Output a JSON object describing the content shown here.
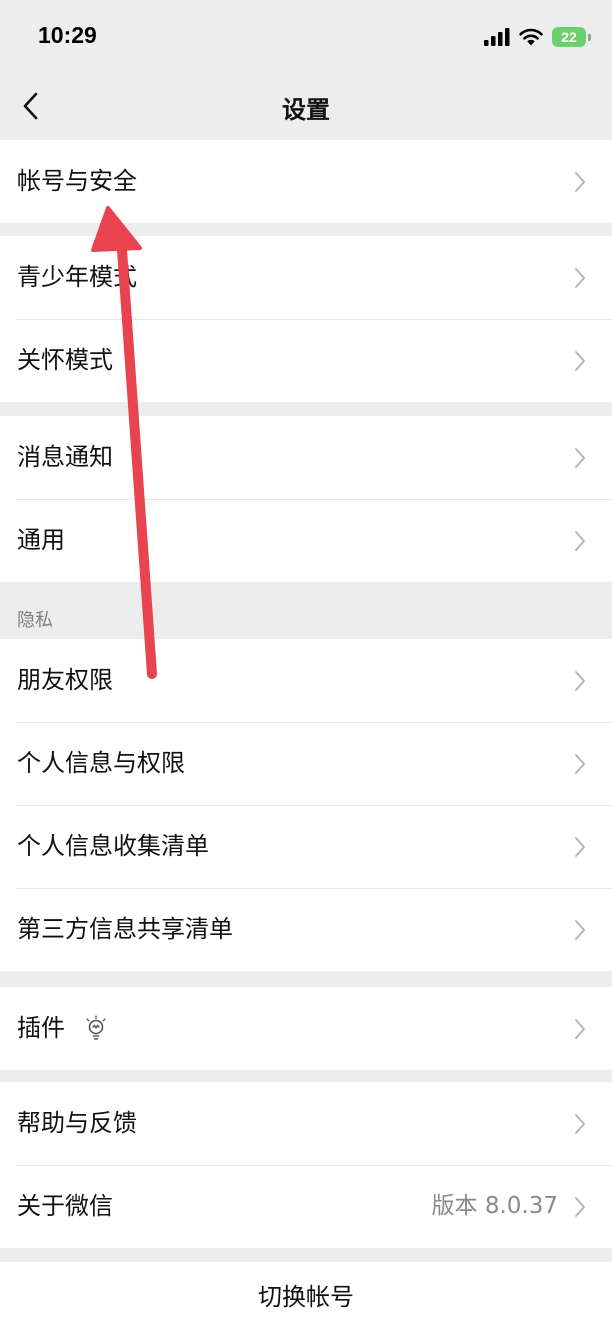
{
  "status_bar": {
    "time": "10:29",
    "battery": "22"
  },
  "nav": {
    "title": "设置"
  },
  "groups": {
    "account": {
      "items": [
        {
          "label": "帐号与安全"
        }
      ]
    },
    "modes": {
      "items": [
        {
          "label": "青少年模式"
        },
        {
          "label": "关怀模式"
        }
      ]
    },
    "general": {
      "items": [
        {
          "label": "消息通知"
        },
        {
          "label": "通用"
        }
      ]
    },
    "privacy": {
      "header": "隐私",
      "items": [
        {
          "label": "朋友权限"
        },
        {
          "label": "个人信息与权限"
        },
        {
          "label": "个人信息收集清单"
        },
        {
          "label": "第三方信息共享清单"
        }
      ]
    },
    "plugins": {
      "items": [
        {
          "label": "插件",
          "icon": "lightbulb-icon"
        }
      ]
    },
    "about": {
      "items": [
        {
          "label": "帮助与反馈"
        },
        {
          "label": "关于微信",
          "value": "版本 8.0.37"
        }
      ]
    }
  },
  "footer": {
    "switch_account": "切换帐号"
  },
  "colors": {
    "background": "#ededed",
    "battery": "#6dd06f",
    "annotation_arrow": "#e8434f"
  }
}
